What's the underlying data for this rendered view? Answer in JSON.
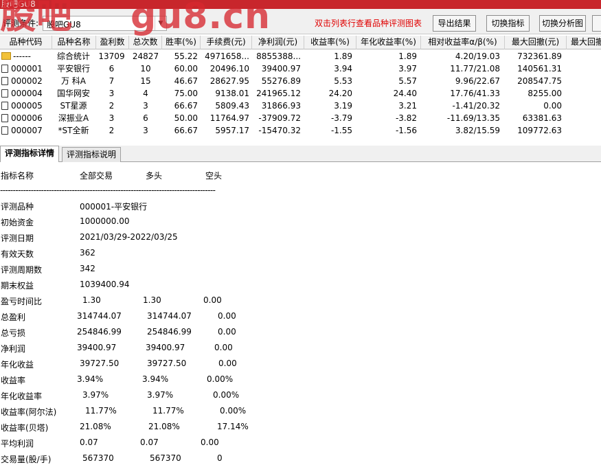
{
  "window": {
    "title": "股吧GU8"
  },
  "watermark": {
    "text1": "股吧",
    "text2": "gu8.cn"
  },
  "toolbar": {
    "condition_label": "评测条件:",
    "condition_value": "股吧GU8",
    "hint": "双击列表行查看品种评测图表",
    "export_label": "导出结果",
    "switch_indicator_label": "切换指标",
    "switch_chart_label": "切换分析图"
  },
  "table": {
    "columns": [
      "品种代码",
      "品种名称",
      "盈利数",
      "总次数",
      "胜率(%)",
      "手续费(元)",
      "净利润(元)",
      "收益率(%)",
      "年化收益率(%)",
      "相对收益率α/β(%)",
      "最大回撤(元)",
      "最大回撤"
    ],
    "rows": [
      {
        "code": "------",
        "name": "综合统计",
        "wins": "13709",
        "total": "24827",
        "win_rate": "55.22",
        "fee": "4971658...",
        "profit": "8855388...",
        "yield": "1.89",
        "annual": "1.89",
        "relative": "4.20/19.03",
        "drawdown": "732361.89"
      },
      {
        "code": "000001",
        "name": "平安银行",
        "wins": "6",
        "total": "10",
        "win_rate": "60.00",
        "fee": "20496.10",
        "profit": "39400.97",
        "yield": "3.94",
        "annual": "3.97",
        "relative": "11.77/21.08",
        "drawdown": "140561.31"
      },
      {
        "code": "000002",
        "name": "万 科A",
        "wins": "7",
        "total": "15",
        "win_rate": "46.67",
        "fee": "28627.95",
        "profit": "55276.89",
        "yield": "5.53",
        "annual": "5.57",
        "relative": "9.96/22.67",
        "drawdown": "208547.75"
      },
      {
        "code": "000004",
        "name": "国华网安",
        "wins": "3",
        "total": "4",
        "win_rate": "75.00",
        "fee": "9138.01",
        "profit": "241965.12",
        "yield": "24.20",
        "annual": "24.40",
        "relative": "17.76/41.33",
        "drawdown": "8255.00"
      },
      {
        "code": "000005",
        "name": "ST星源",
        "wins": "2",
        "total": "3",
        "win_rate": "66.67",
        "fee": "5809.43",
        "profit": "31866.93",
        "yield": "3.19",
        "annual": "3.21",
        "relative": "-1.41/20.32",
        "drawdown": "0.00"
      },
      {
        "code": "000006",
        "name": "深振业A",
        "wins": "3",
        "total": "6",
        "win_rate": "50.00",
        "fee": "11764.97",
        "profit": "-37909.72",
        "yield": "-3.79",
        "annual": "-3.82",
        "relative": "-11.69/13.35",
        "drawdown": "63381.63"
      },
      {
        "code": "000007",
        "name": "*ST全新",
        "wins": "2",
        "total": "3",
        "win_rate": "66.67",
        "fee": "5957.17",
        "profit": "-15470.32",
        "yield": "-1.55",
        "annual": "-1.56",
        "relative": "3.82/15.59",
        "drawdown": "109772.63"
      }
    ]
  },
  "tabs": {
    "detail": "评测指标详情",
    "explain": "评测指标说明"
  },
  "detail": {
    "header": {
      "name": "指标名称",
      "all": "全部交易",
      "long": "多头",
      "short": "空头"
    },
    "separator": "------------------------------------------------------------------------------------",
    "info": [
      {
        "label": "评测品种",
        "value": "000001-平安银行"
      },
      {
        "label": "初始资金",
        "value": "1000000.00"
      },
      {
        "label": "评测日期",
        "value": "2021/03/29-2022/03/25"
      },
      {
        "label": "有效天数",
        "value": "362"
      },
      {
        "label": "评测周期数",
        "value": " 342"
      },
      {
        "label": "期末权益",
        "value": "1039400.94"
      }
    ],
    "metrics": [
      {
        "label": "盈亏时间比",
        "all": " 1.30",
        "long": "1.30",
        "short": "0.00"
      },
      {
        "label": "总盈利",
        "all": "314744.07",
        "long": "314744.07",
        "short": "0.00"
      },
      {
        "label": "总亏损",
        "all": "254846.99",
        "long": "254846.99",
        "short": "0.00"
      },
      {
        "label": "净利润",
        "all": "39400.97",
        "long": "39400.97",
        "short": "0.00"
      },
      {
        "label": "年化收益",
        "all": "39727.50",
        "long": "39727.50",
        "short": "0.00"
      },
      {
        "label": "收益率",
        "all": "3.94%",
        "long": "3.94%",
        "short": "0.00%"
      },
      {
        "label": "年化收益率",
        "all": "3.97%",
        "long": "3.97%",
        "short": "0.00%"
      },
      {
        "label": "收益率(阿尔法)",
        "all": "11.77%",
        "long": "11.77%",
        "short": "0.00%"
      },
      {
        "label": "收益率(贝塔)",
        "all": "21.08%",
        "long": "21.08%",
        "short": "17.14%"
      },
      {
        "label": "平均利润",
        "all": "0.07",
        "long": "0.07",
        "short": "0.00"
      },
      {
        "label": "交易量(股/手)",
        "all": "567370",
        "long": "567370",
        "short": "0"
      }
    ]
  }
}
